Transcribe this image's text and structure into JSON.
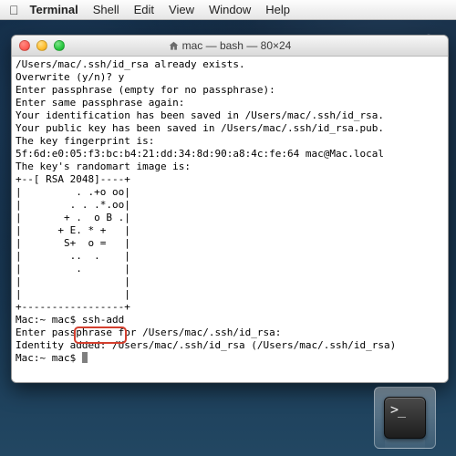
{
  "menubar": {
    "app": "Terminal",
    "items": [
      "Shell",
      "Edit",
      "View",
      "Window",
      "Help"
    ]
  },
  "window": {
    "title": "mac — bash — 80×24"
  },
  "terminal": {
    "lines": [
      "/Users/mac/.ssh/id_rsa already exists.",
      "Overwrite (y/n)? y",
      "Enter passphrase (empty for no passphrase):",
      "Enter same passphrase again:",
      "Your identification has been saved in /Users/mac/.ssh/id_rsa.",
      "Your public key has been saved in /Users/mac/.ssh/id_rsa.pub.",
      "The key fingerprint is:",
      "5f:6d:e0:05:f3:bc:b4:21:dd:34:8d:90:a8:4c:fe:64 mac@Mac.local",
      "The key's randomart image is:",
      "+--[ RSA 2048]----+",
      "|         . .+o oo|",
      "|        . . .*.oo|",
      "|       + .  o B .|",
      "|      + E. * +   |",
      "|       S+  o =   |",
      "|        ..  .    |",
      "|         .       |",
      "|                 |",
      "|                 |",
      "+-----------------+",
      "Mac:~ mac$ ssh-add",
      "Enter passphrase for /Users/mac/.ssh/id_rsa:",
      "Identity added: /Users/mac/.ssh/id_rsa (/Users/mac/.ssh/id_rsa)",
      "Mac:~ mac$ "
    ],
    "highlight_command": "ssh-add"
  },
  "dock": {
    "items": [
      {
        "name": "terminal-app"
      }
    ]
  }
}
